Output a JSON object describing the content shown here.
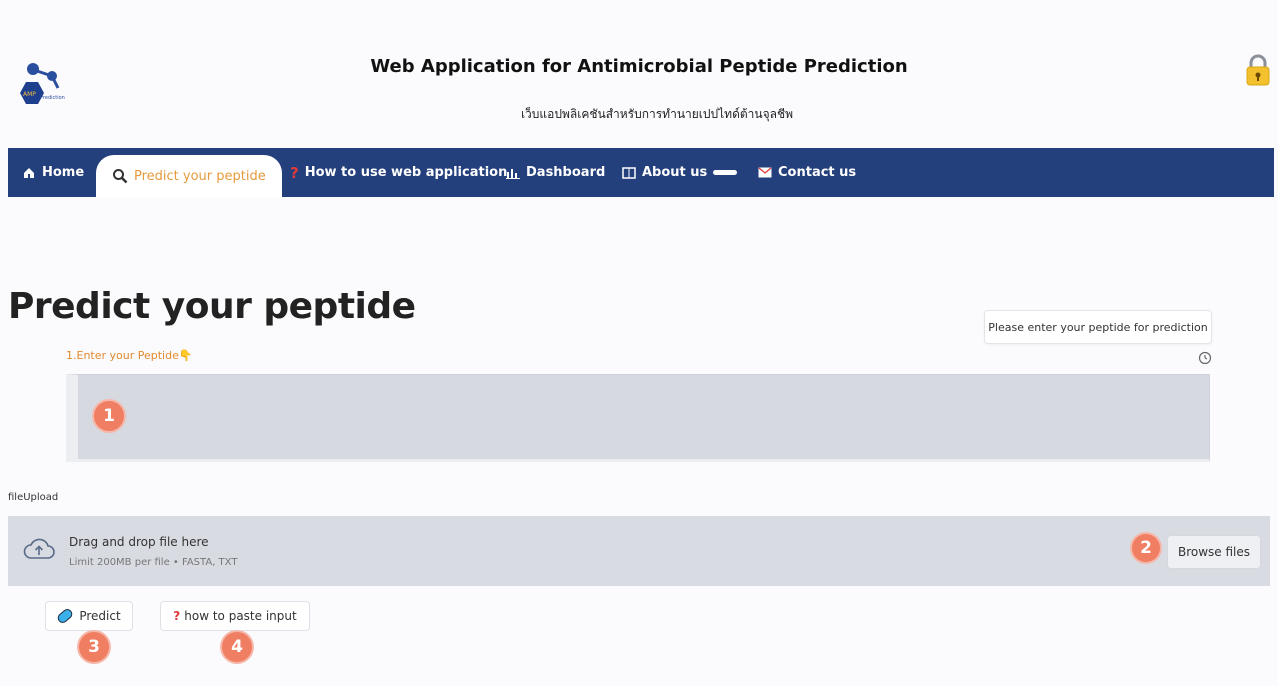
{
  "header": {
    "title": "Web Application for Antimicrobial Peptide Prediction",
    "subtitle": "เว็บแอปพลิเคชันสำหรับการทำนายเปปไทด์ต้านจุลชีพ",
    "logo_text": "AMP Prediction",
    "lock_icon": "lock-icon"
  },
  "nav": {
    "items": [
      {
        "label": "Home",
        "icon": "home-icon"
      },
      {
        "label": "Predict your peptide",
        "icon": "search-icon",
        "active": true
      },
      {
        "label": "How to use web application",
        "icon": "question-icon"
      },
      {
        "label": "Dashboard",
        "icon": "bar-chart-icon"
      },
      {
        "label": "About us",
        "icon": "book-icon"
      },
      {
        "label": "Contact us",
        "icon": "mail-icon"
      }
    ],
    "background": "#233f7c",
    "active_color": "#e69a3c"
  },
  "main": {
    "page_title": "Predict your peptide",
    "tooltip": "Please enter your peptide for prediction",
    "enter_label": "1.Enter your Peptide👇",
    "textarea_value": "",
    "badges": [
      "1",
      "2",
      "3",
      "4"
    ]
  },
  "upload": {
    "label": "fileUpload",
    "title": "Drag and drop file here",
    "limit": "Limit 200MB per file • FASTA, TXT",
    "browse_label": "Browse files"
  },
  "actions": {
    "predict_label": "Predict",
    "howto_label": "how to paste input"
  }
}
